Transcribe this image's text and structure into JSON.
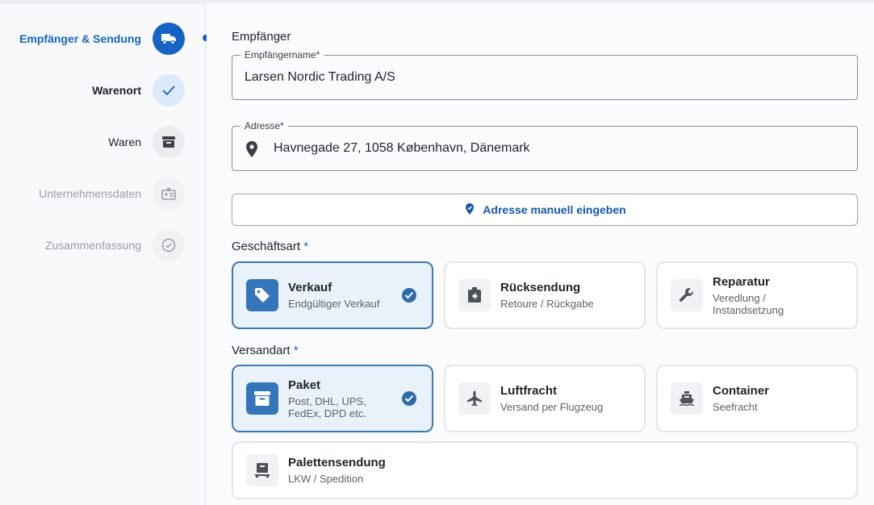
{
  "stepper": {
    "steps": [
      {
        "label": "Empfänger & Sendung",
        "state": "active",
        "icon": "truck-icon"
      },
      {
        "label": "Warenort",
        "state": "done",
        "icon": "check-icon"
      },
      {
        "label": "Waren",
        "state": "pending",
        "icon": "archive-box-icon"
      },
      {
        "label": "Unternehmensdaten",
        "state": "disabled",
        "icon": "id-badge-icon"
      },
      {
        "label": "Zusammenfassung",
        "state": "disabled",
        "icon": "check-circle-icon"
      }
    ]
  },
  "form": {
    "section_title": "Empfänger",
    "recipient": {
      "label": "Empfängername*",
      "value": "Larsen Nordic Trading A/S"
    },
    "address": {
      "label": "Adresse*",
      "value": "Havnegade 27, 1058 København, Dänemark",
      "icon": "location-pin-icon"
    },
    "manual_button": {
      "label": "Adresse manuell eingeben",
      "icon": "map-edit-icon"
    },
    "business_type": {
      "label": "Geschäftsart",
      "required_mark": "*",
      "options": [
        {
          "title": "Verkauf",
          "subtitle": "Endgültiger Verkauf",
          "icon": "tag-icon",
          "selected": true
        },
        {
          "title": "Rücksendung",
          "subtitle": "Retoure / Rückgabe",
          "icon": "return-box-icon",
          "selected": false
        },
        {
          "title": "Reparatur",
          "subtitle": "Veredlung / Instandsetzung",
          "icon": "wrench-icon",
          "selected": false
        }
      ]
    },
    "shipping_type": {
      "label": "Versandart",
      "required_mark": "*",
      "options": [
        {
          "title": "Paket",
          "subtitle": "Post, DHL, UPS, FedEx, DPD etc.",
          "icon": "package-icon",
          "selected": true
        },
        {
          "title": "Luftfracht",
          "subtitle": "Versand per Flugzeug",
          "icon": "airplane-icon",
          "selected": false
        },
        {
          "title": "Container",
          "subtitle": "Seefracht",
          "icon": "ship-icon",
          "selected": false
        },
        {
          "title": "Palettensendung",
          "subtitle": "LKW / Spedition",
          "icon": "pallet-icon",
          "selected": false
        }
      ]
    }
  },
  "colors": {
    "accent": "#1663c5",
    "selected_bg": "#e9f2fb",
    "selected_border": "#3b78b5"
  }
}
